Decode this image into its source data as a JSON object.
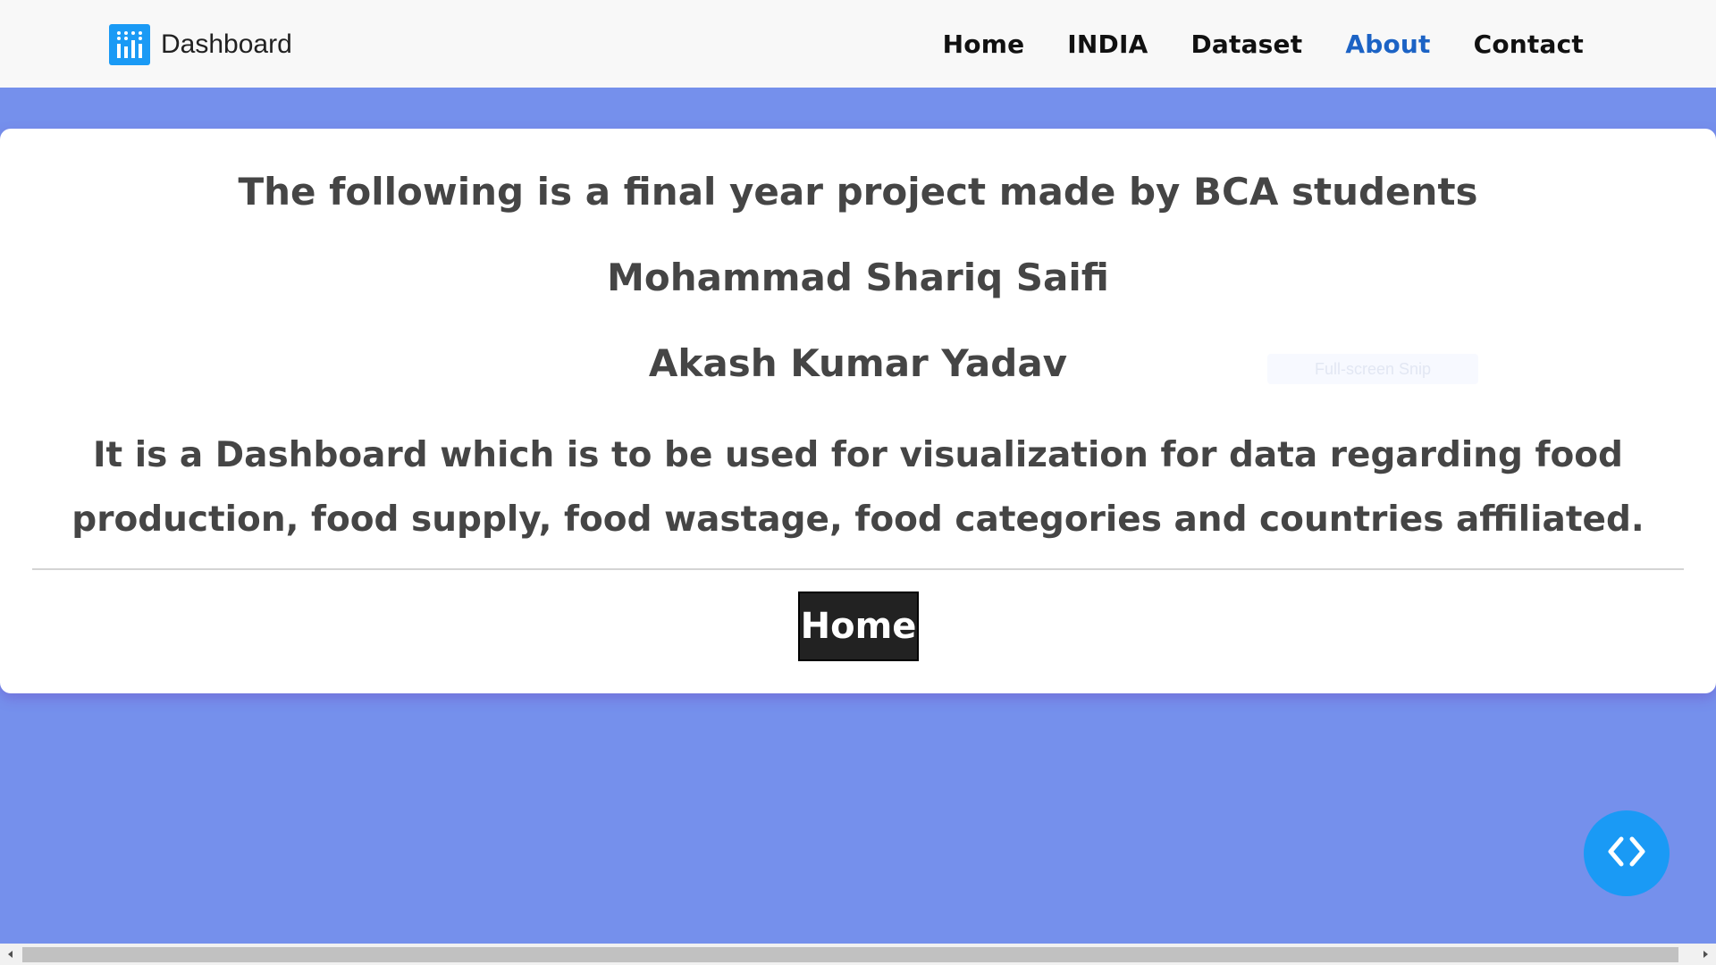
{
  "brand": {
    "name": "Dashboard",
    "logo_icon": "bar-chart-icon",
    "logo_color": "#1a9af5"
  },
  "nav": {
    "items": [
      {
        "label": "Home",
        "active": false
      },
      {
        "label": "INDIA",
        "active": false
      },
      {
        "label": "Dataset",
        "active": false
      },
      {
        "label": "About",
        "active": true
      },
      {
        "label": "Contact",
        "active": false
      }
    ],
    "active_color": "#1c63c5"
  },
  "about": {
    "heading": "The following is a final year project made by BCA students",
    "student_1": "Mohammad Shariq Saifi",
    "student_2": "Akash Kumar Yadav",
    "description": "It is a Dashboard which is to be used for visualization for data regarding food production, food supply, food wastage, food categories and countries affiliated.",
    "home_button": "Home"
  },
  "overlay": {
    "ghost_text": "Full-screen Snip"
  },
  "fab": {
    "icon": "code-brackets-icon",
    "color": "#1a9af5"
  },
  "colors": {
    "background": "#7590ec",
    "navbar": "#f8f8f8",
    "text": "#454545"
  }
}
